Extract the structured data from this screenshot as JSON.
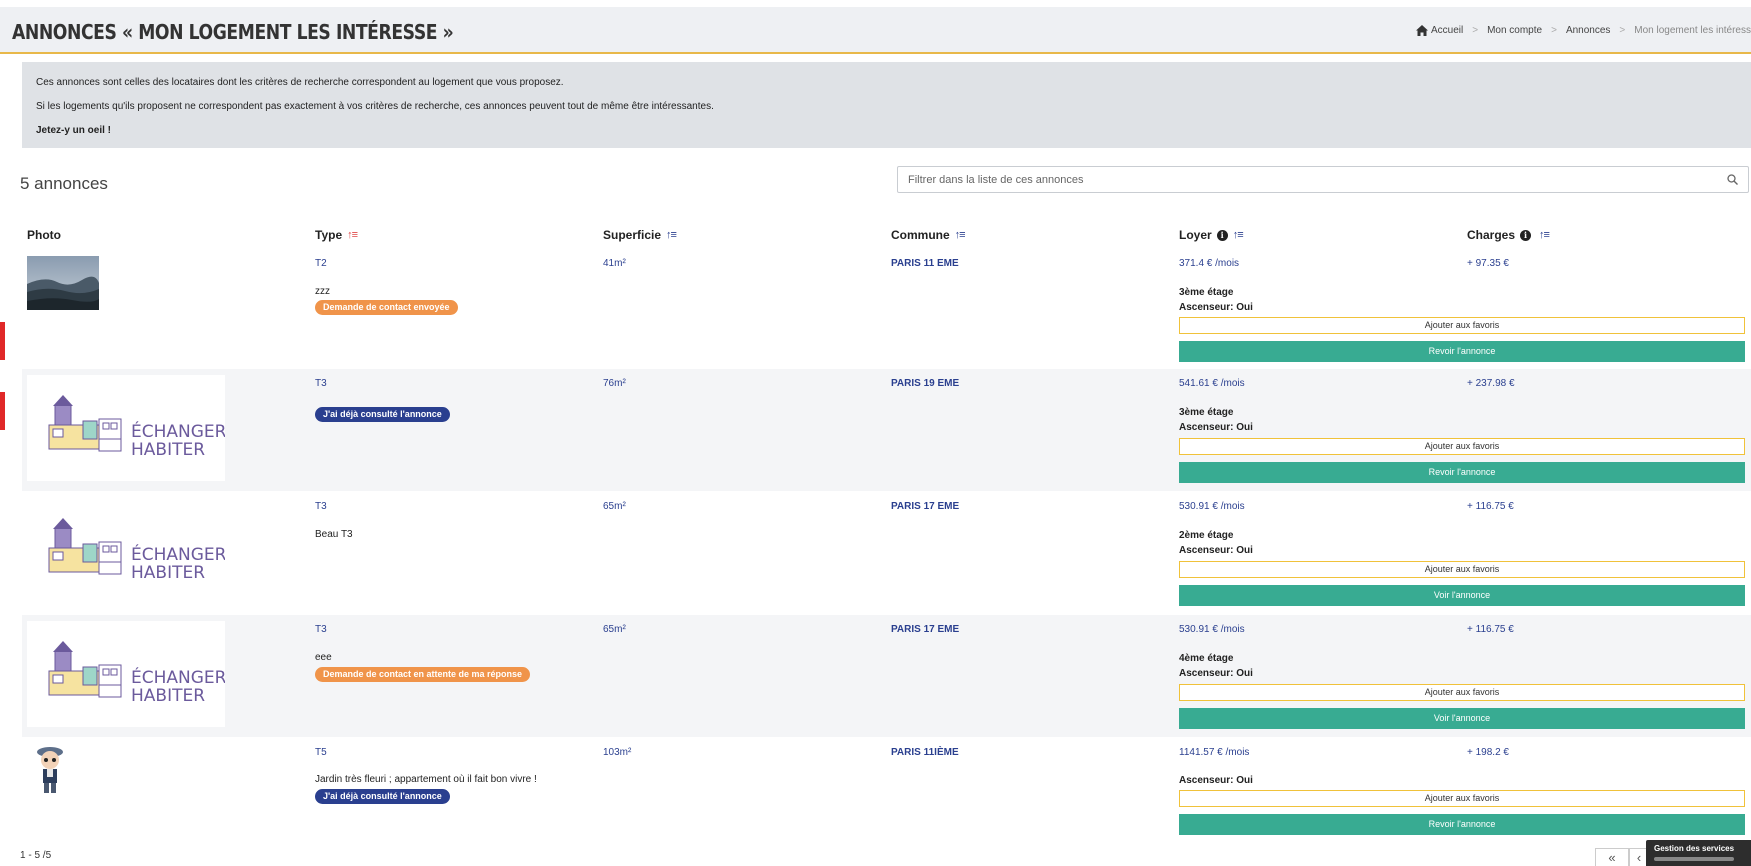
{
  "header": {
    "title": "ANNONCES « MON LOGEMENT LES INTÉRESSE »",
    "breadcrumb": [
      "Accueil",
      "Mon compte",
      "Annonces",
      "Mon logement les intéress"
    ],
    "separator": ">"
  },
  "info": {
    "line1": "Ces annonces sont celles des locataires dont les critères de recherche correspondent au logement que vous proposez.",
    "line2": "Si les logements qu'ils proposent ne correspondent pas exactement à vos critères de recherche, ces annonces peuvent tout de même être intéressantes.",
    "line3": "Jetez-y un oeil !"
  },
  "listing": {
    "count_label": "5 annonces",
    "filter_placeholder": "Filtrer dans la liste de ces annonces",
    "columns": {
      "photo": "Photo",
      "type": "Type",
      "superficie": "Superficie",
      "commune": "Commune",
      "loyer": "Loyer",
      "charges": "Charges"
    },
    "rows": [
      {
        "type": "T2",
        "superficie": "41m²",
        "commune": "PARIS 11 EME",
        "loyer": "371.4 € /mois",
        "charges": "+ 97.35 €",
        "description": "zzz",
        "badge": "Demande de contact envoyée",
        "etage": "3ème étage",
        "ascenseur": "Ascenseur: Oui",
        "fav_label": "Ajouter aux favoris",
        "action_label": "Revoir l'annonce"
      },
      {
        "type": "T3",
        "superficie": "76m²",
        "commune": "PARIS 19 EME",
        "loyer": "541.61 € /mois",
        "charges": "+ 237.98 €",
        "description": "",
        "badge": "J'ai déjà consulté l'annonce",
        "etage": "3ème étage",
        "ascenseur": "Ascenseur: Oui",
        "fav_label": "Ajouter aux favoris",
        "action_label": "Revoir l'annonce"
      },
      {
        "type": "T3",
        "superficie": "65m²",
        "commune": "PARIS 17 EME",
        "loyer": "530.91 € /mois",
        "charges": "+ 116.75 €",
        "description": "Beau T3",
        "badge": "",
        "etage": "2ème étage",
        "ascenseur": "Ascenseur: Oui",
        "fav_label": "Ajouter aux favoris",
        "action_label": "Voir l'annonce"
      },
      {
        "type": "T3",
        "superficie": "65m²",
        "commune": "PARIS 17 EME",
        "loyer": "530.91 € /mois",
        "charges": "+ 116.75 €",
        "description": "eee",
        "badge": "Demande de contact en attente de ma réponse",
        "etage": "4ème étage",
        "ascenseur": "Ascenseur: Oui",
        "fav_label": "Ajouter aux favoris",
        "action_label": "Voir l'annonce"
      },
      {
        "type": "T5",
        "superficie": "103m²",
        "commune": "PARIS 11IÈME",
        "loyer": "1141.57 € /mois",
        "charges": "+ 198.2 €",
        "description": "Jardin très fleuri ; appartement où il fait bon vivre !",
        "badge": "J'ai déjà consulté l'annonce",
        "etage": "",
        "ascenseur": "Ascenseur: Oui",
        "fav_label": "Ajouter aux favoris",
        "action_label": "Revoir l'annonce"
      }
    ],
    "logo_text_1": "ÉCHANGER",
    "logo_text_2": "HABITER",
    "pagination": "1 - 5 /5",
    "pager_first": "«",
    "pager_prev": "‹"
  },
  "widget": {
    "label": "Gestion des services"
  },
  "colors": {
    "accent": "#e8b84a",
    "teal": "#38ab92",
    "navy": "#2a3f8f",
    "orange": "#f0944a"
  }
}
